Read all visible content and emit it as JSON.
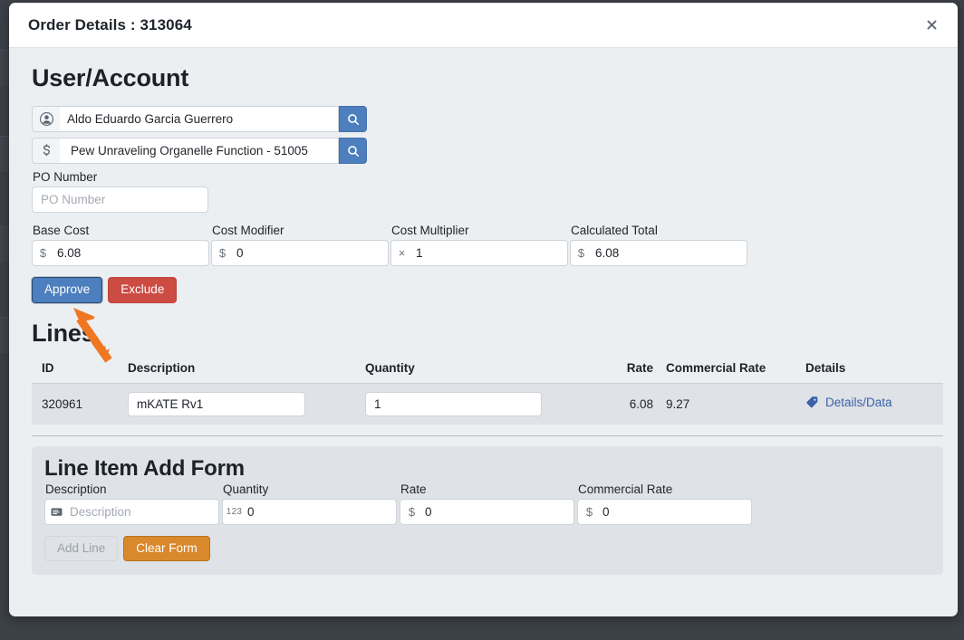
{
  "modal": {
    "title": "Order Details : 313064",
    "close_icon": "close-icon"
  },
  "user_account": {
    "heading": "User/Account",
    "user_icon": "person-icon",
    "user_value": "Aldo Eduardo Garcia Guerrero",
    "user_search_icon": "search-icon",
    "account_icon": "dollar-icon",
    "account_value": "Pew Unraveling Organelle Function - 51005",
    "account_search_icon": "search-icon"
  },
  "po": {
    "label": "PO Number",
    "placeholder": "PO Number",
    "value": ""
  },
  "costs": [
    {
      "label": "Base Cost",
      "prefix": "$",
      "value": "6.08"
    },
    {
      "label": "Cost Modifier",
      "prefix": "$",
      "value": "0"
    },
    {
      "label": "Cost Multiplier",
      "prefix": "×",
      "value": "1"
    },
    {
      "label": "Calculated Total",
      "prefix": "$",
      "value": "6.08"
    }
  ],
  "actions": {
    "approve_label": "Approve",
    "exclude_label": "Exclude"
  },
  "lines": {
    "heading": "Lines",
    "columns": [
      "ID",
      "Description",
      "Quantity",
      "Rate",
      "Commercial Rate",
      "Details"
    ],
    "rows": [
      {
        "id": "320961",
        "description": "mKATE Rv1",
        "quantity": "1",
        "rate": "6.08",
        "commercial_rate": "9.27",
        "details_label": "Details/Data",
        "details_icon": "tag-icon"
      }
    ]
  },
  "add_form": {
    "heading": "Line Item Add Form",
    "fields": [
      {
        "label": "Description",
        "prefix_icon": "card-icon",
        "prefix": "",
        "placeholder": "Description",
        "value": ""
      },
      {
        "label": "Quantity",
        "prefix_icon": "number-icon",
        "prefix": "123",
        "placeholder": "",
        "value": "0"
      },
      {
        "label": "Rate",
        "prefix_icon": "dollar-icon",
        "prefix": "$",
        "placeholder": "",
        "value": "0"
      },
      {
        "label": "Commercial Rate",
        "prefix_icon": "dollar-icon",
        "prefix": "$",
        "placeholder": "",
        "value": "0"
      }
    ],
    "add_line_label": "Add Line",
    "clear_form_label": "Clear Form"
  },
  "annotation": {
    "arrow_color": "#ef7722",
    "points_at": "Approve"
  },
  "colors": {
    "accent_blue": "#4d7ebd",
    "danger_red": "#cc4b42",
    "warning_orange": "#d9882b",
    "link_blue": "#3b62a8",
    "modal_bg": "#eceff1",
    "panel_bg": "#dfe2e7"
  }
}
